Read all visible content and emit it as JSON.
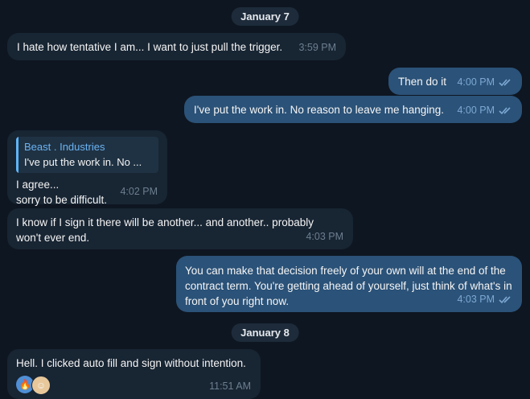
{
  "colors": {
    "background": "#0e1621",
    "incoming_bubble": "#182533",
    "outgoing_bubble": "#2b5278",
    "reply_accent": "#5eb5f7",
    "date_pill": "#1d2b3a"
  },
  "dates": {
    "first": "January 7",
    "second": "January 8"
  },
  "messages": [
    {
      "direction": "in",
      "text": "I hate how tentative I am... I want to just pull the trigger.",
      "time": "3:59 PM"
    },
    {
      "direction": "out",
      "text": "Then do it",
      "time": "4:00 PM",
      "status_icon": "double-check-icon"
    },
    {
      "direction": "out",
      "text": "I've put the work in. No reason to leave me hanging.",
      "time": "4:00 PM",
      "status_icon": "double-check-icon"
    },
    {
      "direction": "in",
      "reply": {
        "author": "Beast . Industries",
        "text": "I've put the work in. No ..."
      },
      "line1": "I agree...",
      "line2": "sorry to be difficult.",
      "time": "4:02 PM"
    },
    {
      "direction": "in",
      "text": "I know if I sign it there will be another... and another.. probably won't ever end.",
      "time": "4:03 PM"
    },
    {
      "direction": "out",
      "text": "You can make that decision freely of your own will at the end of the contract term. You're getting ahead of yourself, just think of what's in front of you right now.",
      "time": "4:03 PM",
      "status_icon": "double-check-icon"
    },
    {
      "direction": "in",
      "text": "Hell. I clicked auto fill and sign without intention.",
      "time": "11:51 AM",
      "reactions": [
        {
          "emoji": "🔥",
          "icon": "fire-reaction-icon"
        },
        {
          "emoji": "☺",
          "icon": "user-avatar-reaction-icon"
        }
      ]
    }
  ]
}
